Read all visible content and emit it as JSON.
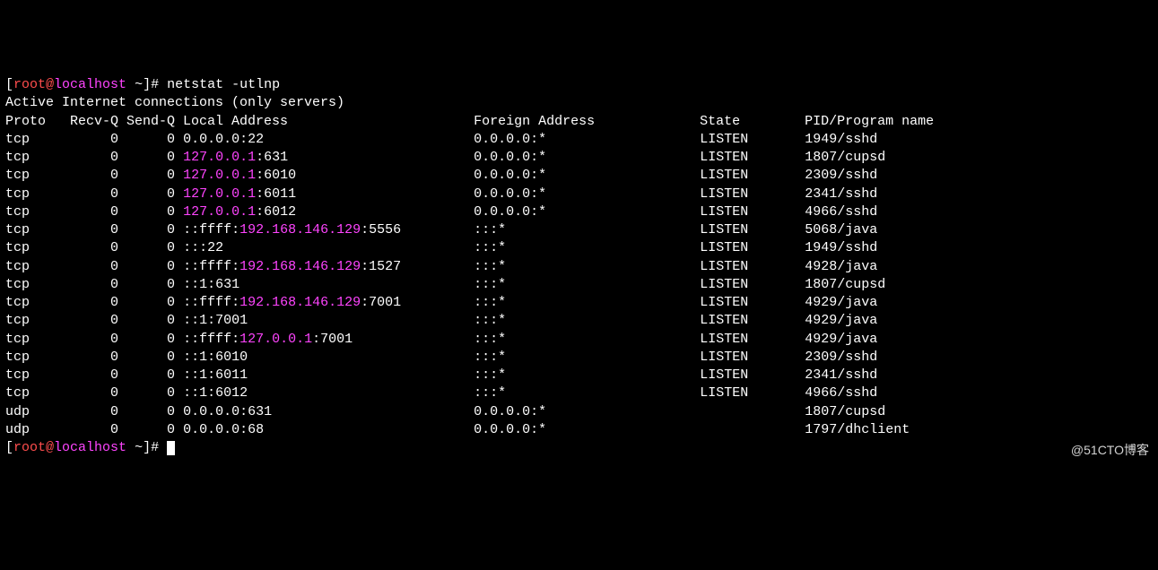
{
  "prompt": {
    "open": "[",
    "user": "root",
    "at": "@",
    "host": "localhost",
    "tilde": " ~",
    "close": "]",
    "hash": "# "
  },
  "command": "netstat -utlnp",
  "header": "Active Internet connections (only servers)",
  "columns": {
    "proto": "Proto",
    "recvq": "Recv-Q",
    "sendq": "Send-Q",
    "local": "Local Address",
    "foreign": "Foreign Address",
    "state": "State",
    "program": "PID/Program name"
  },
  "rows": [
    {
      "proto": "tcp",
      "recvq": "0",
      "sendq": "0",
      "local_pre": "0.0.0.0:22",
      "local_hi": "",
      "local_post": "",
      "foreign": "0.0.0.0:*",
      "state": "LISTEN",
      "prog": "1949/sshd"
    },
    {
      "proto": "tcp",
      "recvq": "0",
      "sendq": "0",
      "local_pre": "",
      "local_hi": "127.0.0.1",
      "local_post": ":631",
      "foreign": "0.0.0.0:*",
      "state": "LISTEN",
      "prog": "1807/cupsd"
    },
    {
      "proto": "tcp",
      "recvq": "0",
      "sendq": "0",
      "local_pre": "",
      "local_hi": "127.0.0.1",
      "local_post": ":6010",
      "foreign": "0.0.0.0:*",
      "state": "LISTEN",
      "prog": "2309/sshd"
    },
    {
      "proto": "tcp",
      "recvq": "0",
      "sendq": "0",
      "local_pre": "",
      "local_hi": "127.0.0.1",
      "local_post": ":6011",
      "foreign": "0.0.0.0:*",
      "state": "LISTEN",
      "prog": "2341/sshd"
    },
    {
      "proto": "tcp",
      "recvq": "0",
      "sendq": "0",
      "local_pre": "",
      "local_hi": "127.0.0.1",
      "local_post": ":6012",
      "foreign": "0.0.0.0:*",
      "state": "LISTEN",
      "prog": "4966/sshd"
    },
    {
      "proto": "tcp",
      "recvq": "0",
      "sendq": "0",
      "local_pre": "::ffff:",
      "local_hi": "192.168.146.129",
      "local_post": ":5556",
      "foreign": ":::*",
      "state": "LISTEN",
      "prog": "5068/java"
    },
    {
      "proto": "tcp",
      "recvq": "0",
      "sendq": "0",
      "local_pre": ":::22",
      "local_hi": "",
      "local_post": "",
      "foreign": ":::*",
      "state": "LISTEN",
      "prog": "1949/sshd"
    },
    {
      "proto": "tcp",
      "recvq": "0",
      "sendq": "0",
      "local_pre": "::ffff:",
      "local_hi": "192.168.146.129",
      "local_post": ":1527",
      "foreign": ":::*",
      "state": "LISTEN",
      "prog": "4928/java"
    },
    {
      "proto": "tcp",
      "recvq": "0",
      "sendq": "0",
      "local_pre": "::1:631",
      "local_hi": "",
      "local_post": "",
      "foreign": ":::*",
      "state": "LISTEN",
      "prog": "1807/cupsd"
    },
    {
      "proto": "tcp",
      "recvq": "0",
      "sendq": "0",
      "local_pre": "::ffff:",
      "local_hi": "192.168.146.129",
      "local_post": ":7001",
      "foreign": ":::*",
      "state": "LISTEN",
      "prog": "4929/java"
    },
    {
      "proto": "tcp",
      "recvq": "0",
      "sendq": "0",
      "local_pre": "::1:7001",
      "local_hi": "",
      "local_post": "",
      "foreign": ":::*",
      "state": "LISTEN",
      "prog": "4929/java"
    },
    {
      "proto": "tcp",
      "recvq": "0",
      "sendq": "0",
      "local_pre": "::ffff:",
      "local_hi": "127.0.0.1",
      "local_post": ":7001",
      "foreign": ":::*",
      "state": "LISTEN",
      "prog": "4929/java"
    },
    {
      "proto": "tcp",
      "recvq": "0",
      "sendq": "0",
      "local_pre": "::1:6010",
      "local_hi": "",
      "local_post": "",
      "foreign": ":::*",
      "state": "LISTEN",
      "prog": "2309/sshd"
    },
    {
      "proto": "tcp",
      "recvq": "0",
      "sendq": "0",
      "local_pre": "::1:6011",
      "local_hi": "",
      "local_post": "",
      "foreign": ":::*",
      "state": "LISTEN",
      "prog": "2341/sshd"
    },
    {
      "proto": "tcp",
      "recvq": "0",
      "sendq": "0",
      "local_pre": "::1:6012",
      "local_hi": "",
      "local_post": "",
      "foreign": ":::*",
      "state": "LISTEN",
      "prog": "4966/sshd"
    },
    {
      "proto": "udp",
      "recvq": "0",
      "sendq": "0",
      "local_pre": "0.0.0.0:631",
      "local_hi": "",
      "local_post": "",
      "foreign": "0.0.0.0:*",
      "state": "",
      "prog": "1807/cupsd"
    },
    {
      "proto": "udp",
      "recvq": "0",
      "sendq": "0",
      "local_pre": "0.0.0.0:68",
      "local_hi": "",
      "local_post": "",
      "foreign": "0.0.0.0:*",
      "state": "",
      "prog": "1797/dhclient"
    }
  ],
  "watermark": "@51CTO博客",
  "col_widths": {
    "proto": 8,
    "recvq": 7,
    "sendq": 7,
    "local": 36,
    "foreign": 28,
    "state": 13
  }
}
